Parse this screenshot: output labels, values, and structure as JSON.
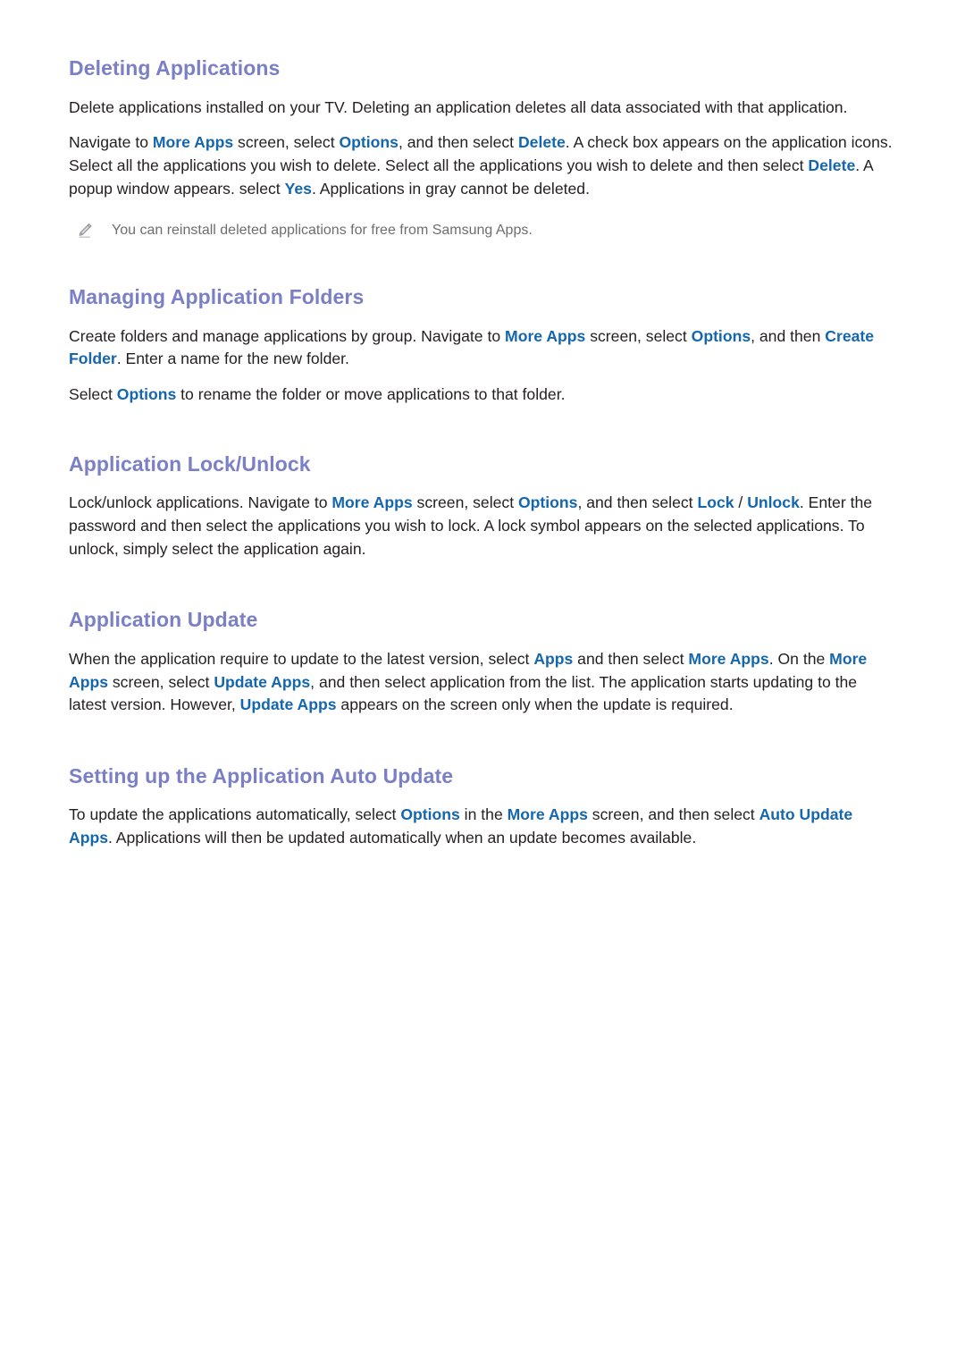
{
  "document": {
    "page_background": "#ffffff",
    "heading_color": "#7b80c6",
    "term_color": "#1466ae",
    "body_color": "#231f20",
    "note_color": "#6d6e70"
  },
  "sections": {
    "deleting": {
      "heading": "Deleting Applications",
      "p1": {
        "t1": "Delete applications installed on your TV. Deleting an application deletes all data associated with that application."
      },
      "p2": {
        "t1": "Navigate to ",
        "term1": "More Apps",
        "t2": " screen, select ",
        "term2": "Options",
        "t3": ", and then select ",
        "term3": "Delete",
        "t4": ". A check box appears on the application icons. Select all the applications you wish to delete. Select all the applications you wish to delete and then select ",
        "term4": "Delete",
        "t5": ". A popup window appears. select ",
        "term5": "Yes",
        "t6": ". Applications in gray cannot be deleted."
      },
      "note": {
        "icon": "pencil-icon",
        "text": "You can reinstall deleted applications for free from Samsung Apps."
      }
    },
    "managing": {
      "heading": "Managing Application Folders",
      "p1": {
        "t1": "Create folders and manage applications by group. Navigate to ",
        "term1": "More Apps",
        "t2": " screen, select ",
        "term2": "Options",
        "t3": ", and then ",
        "term3": "Create Folder",
        "t4": ". Enter a name for the new folder."
      },
      "p2": {
        "t1": "Select ",
        "term1": "Options",
        "t2": " to rename the folder or move applications to that folder."
      }
    },
    "lock": {
      "heading": "Application Lock/Unlock",
      "p1": {
        "t1": "Lock/unlock applications. Navigate to ",
        "term1": "More Apps",
        "t2": " screen, select ",
        "term2": "Options",
        "t3": ", and then select ",
        "term3": "Lock",
        "t4": " / ",
        "term4": "Unlock",
        "t5": ". Enter the password and then select the applications you wish to lock. A lock symbol appears on the selected applications. To unlock, simply select the application again."
      }
    },
    "update": {
      "heading": "Application Update",
      "p1": {
        "t1": "When the application require to update to the latest version, select ",
        "term1": "Apps",
        "t2": " and then select ",
        "term2": "More Apps",
        "t3": ". On the ",
        "term3": "More Apps",
        "t4": " screen, select ",
        "term4": "Update Apps",
        "t5": ", and then select application from the list. The application starts updating to the latest version. However, ",
        "term5": "Update Apps",
        "t6": " appears on the screen only when the update is required."
      }
    },
    "autoupdate": {
      "heading": "Setting up the Application Auto Update",
      "p1": {
        "t1": "To update the applications automatically, select ",
        "term1": "Options",
        "t2": " in the ",
        "term2": "More Apps",
        "t3": " screen, and then select ",
        "term3": "Auto Update Apps",
        "t4": ". Applications will then be updated automatically when an update becomes available."
      }
    }
  }
}
